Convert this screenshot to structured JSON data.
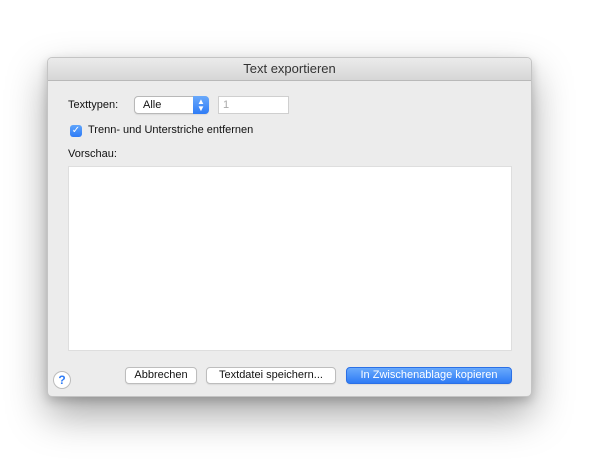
{
  "dialog": {
    "title": "Text exportieren"
  },
  "texttypes": {
    "label": "Texttypen:",
    "selected": "Alle",
    "number_value": "1"
  },
  "options": {
    "remove_hyphens_label": "Trenn- und Unterstriche entfernen",
    "remove_hyphens_checked": true
  },
  "preview": {
    "label": "Vorschau:",
    "content": ""
  },
  "buttons": {
    "help": "?",
    "cancel": "Abbrechen",
    "save_textfile": "Textdatei speichern...",
    "copy_clipboard": "In Zwischenablage kopieren"
  },
  "icons": {
    "popup_arrows": "up-down-chevron-icon",
    "checkbox": "checkmark-icon",
    "help": "help-icon"
  },
  "colors": {
    "accent": "#2f7cf6",
    "dialog_bg": "#ececec"
  }
}
